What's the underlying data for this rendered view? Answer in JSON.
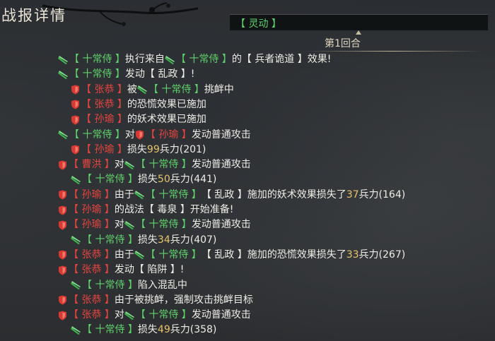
{
  "title": "战报详情",
  "header": {
    "tag": "【 灵动 】"
  },
  "round": {
    "label": "第1回合"
  },
  "colors": {
    "ally": "#5fd16b",
    "enemy": "#e8453f",
    "number": "#e7c46a",
    "text": "#eeece6"
  },
  "log": [
    {
      "indent": 0,
      "segments": [
        {
          "t": "icon",
          "v": "green-blade-icon"
        },
        {
          "t": "g",
          "v": "【 十常侍 】"
        },
        {
          "t": "w",
          "v": "执行来自"
        },
        {
          "t": "icon",
          "v": "green-blade-icon"
        },
        {
          "t": "g",
          "v": "【 十常侍 】"
        },
        {
          "t": "w",
          "v": "的【 兵者诡道 】效果!"
        }
      ]
    },
    {
      "indent": 0,
      "segments": [
        {
          "t": "icon",
          "v": "green-blade-icon"
        },
        {
          "t": "g",
          "v": "【 十常侍 】"
        },
        {
          "t": "w",
          "v": "发动【 乱政 】!"
        }
      ]
    },
    {
      "indent": 1,
      "segments": [
        {
          "t": "icon",
          "v": "red-shield-icon"
        },
        {
          "t": "r",
          "v": "【 张恭 】"
        },
        {
          "t": "w",
          "v": "被"
        },
        {
          "t": "icon",
          "v": "green-blade-icon"
        },
        {
          "t": "g",
          "v": "【 十常侍 】"
        },
        {
          "t": "w",
          "v": "挑衅中"
        }
      ]
    },
    {
      "indent": 1,
      "segments": [
        {
          "t": "icon",
          "v": "red-shield-icon"
        },
        {
          "t": "r",
          "v": "【 张恭 】"
        },
        {
          "t": "w",
          "v": "的恐慌效果已施加"
        }
      ]
    },
    {
      "indent": 1,
      "segments": [
        {
          "t": "icon",
          "v": "red-shield-icon"
        },
        {
          "t": "r",
          "v": "【 孙瑜 】"
        },
        {
          "t": "w",
          "v": "的妖术效果已施加"
        }
      ]
    },
    {
      "indent": 0,
      "segments": [
        {
          "t": "icon",
          "v": "green-blade-icon"
        },
        {
          "t": "g",
          "v": "【 十常侍 】"
        },
        {
          "t": "w",
          "v": "对"
        },
        {
          "t": "icon",
          "v": "red-shield-icon"
        },
        {
          "t": "r",
          "v": "【 孙瑜 】"
        },
        {
          "t": "w",
          "v": "发动普通攻击"
        }
      ]
    },
    {
      "indent": 1,
      "segments": [
        {
          "t": "icon",
          "v": "red-shield-icon"
        },
        {
          "t": "r",
          "v": "【 孙瑜 】"
        },
        {
          "t": "w",
          "v": "损失"
        },
        {
          "t": "n",
          "v": "99"
        },
        {
          "t": "w",
          "v": "兵力(201)"
        }
      ]
    },
    {
      "indent": 0,
      "segments": [
        {
          "t": "icon",
          "v": "red-shield-icon"
        },
        {
          "t": "r",
          "v": "【 曹洪 】"
        },
        {
          "t": "w",
          "v": "对"
        },
        {
          "t": "icon",
          "v": "green-blade-icon"
        },
        {
          "t": "g",
          "v": "【 十常侍 】"
        },
        {
          "t": "w",
          "v": "发动普通攻击"
        }
      ]
    },
    {
      "indent": 1,
      "segments": [
        {
          "t": "icon",
          "v": "green-blade-icon"
        },
        {
          "t": "g",
          "v": "【 十常侍 】"
        },
        {
          "t": "w",
          "v": "损失"
        },
        {
          "t": "n",
          "v": "50"
        },
        {
          "t": "w",
          "v": "兵力(441)"
        }
      ]
    },
    {
      "indent": 0,
      "segments": [
        {
          "t": "icon",
          "v": "red-shield-icon"
        },
        {
          "t": "r",
          "v": "【 孙瑜 】"
        },
        {
          "t": "w",
          "v": "由于"
        },
        {
          "t": "icon",
          "v": "green-blade-icon"
        },
        {
          "t": "g",
          "v": "【 十常侍 】"
        },
        {
          "t": "w",
          "v": "【 乱政 】施加的妖术效果损失了"
        },
        {
          "t": "n",
          "v": "37"
        },
        {
          "t": "w",
          "v": "兵力(164)"
        }
      ]
    },
    {
      "indent": 0,
      "segments": [
        {
          "t": "icon",
          "v": "red-shield-icon"
        },
        {
          "t": "r",
          "v": "【 孙瑜 】"
        },
        {
          "t": "w",
          "v": "的战法【 毒泉 】开始准备!"
        }
      ]
    },
    {
      "indent": 0,
      "segments": [
        {
          "t": "icon",
          "v": "red-shield-icon"
        },
        {
          "t": "r",
          "v": "【 孙瑜 】"
        },
        {
          "t": "w",
          "v": "对"
        },
        {
          "t": "icon",
          "v": "green-blade-icon"
        },
        {
          "t": "g",
          "v": "【 十常侍 】"
        },
        {
          "t": "w",
          "v": "发动普通攻击"
        }
      ]
    },
    {
      "indent": 1,
      "segments": [
        {
          "t": "icon",
          "v": "green-blade-icon"
        },
        {
          "t": "g",
          "v": "【 十常侍 】"
        },
        {
          "t": "w",
          "v": "损失"
        },
        {
          "t": "n",
          "v": "34"
        },
        {
          "t": "w",
          "v": "兵力(407)"
        }
      ]
    },
    {
      "indent": 0,
      "segments": [
        {
          "t": "icon",
          "v": "red-shield-icon"
        },
        {
          "t": "r",
          "v": "【 张恭 】"
        },
        {
          "t": "w",
          "v": "由于"
        },
        {
          "t": "icon",
          "v": "green-blade-icon"
        },
        {
          "t": "g",
          "v": "【 十常侍 】"
        },
        {
          "t": "w",
          "v": "【 乱政 】施加的恐慌效果损失了"
        },
        {
          "t": "n",
          "v": "33"
        },
        {
          "t": "w",
          "v": "兵力(267)"
        }
      ]
    },
    {
      "indent": 0,
      "segments": [
        {
          "t": "icon",
          "v": "red-shield-icon"
        },
        {
          "t": "r",
          "v": "【 张恭 】"
        },
        {
          "t": "w",
          "v": "发动【 陷阱 】!"
        }
      ]
    },
    {
      "indent": 1,
      "segments": [
        {
          "t": "icon",
          "v": "green-blade-icon"
        },
        {
          "t": "g",
          "v": "【 十常侍 】"
        },
        {
          "t": "w",
          "v": "陷入混乱中"
        }
      ]
    },
    {
      "indent": 0,
      "segments": [
        {
          "t": "icon",
          "v": "red-shield-icon"
        },
        {
          "t": "r",
          "v": "【 张恭 】"
        },
        {
          "t": "w",
          "v": "由于被挑衅，强制攻击挑衅目标"
        }
      ]
    },
    {
      "indent": 0,
      "segments": [
        {
          "t": "icon",
          "v": "red-shield-icon"
        },
        {
          "t": "r",
          "v": "【 张恭 】"
        },
        {
          "t": "w",
          "v": "对"
        },
        {
          "t": "icon",
          "v": "green-blade-icon"
        },
        {
          "t": "g",
          "v": "【 十常侍 】"
        },
        {
          "t": "w",
          "v": "发动普通攻击"
        }
      ]
    },
    {
      "indent": 1,
      "segments": [
        {
          "t": "icon",
          "v": "green-blade-icon"
        },
        {
          "t": "g",
          "v": "【 十常侍 】"
        },
        {
          "t": "w",
          "v": "损失"
        },
        {
          "t": "n",
          "v": "49"
        },
        {
          "t": "w",
          "v": "兵力(358)"
        }
      ]
    }
  ]
}
